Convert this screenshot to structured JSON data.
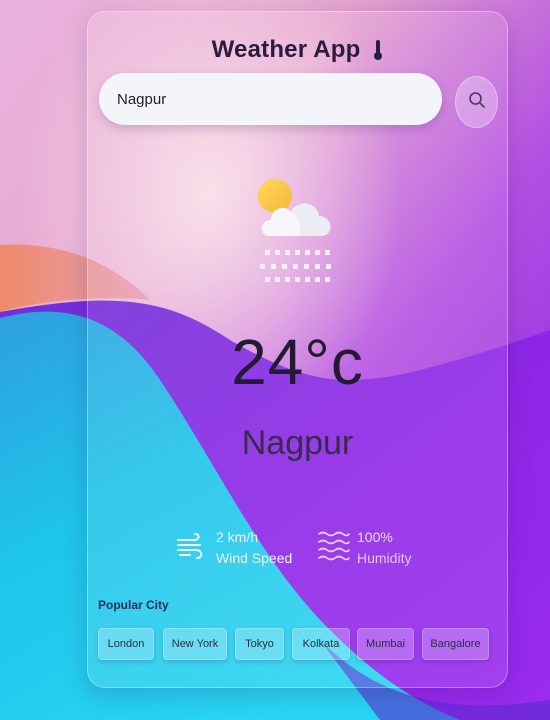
{
  "app": {
    "title": "Weather App",
    "title_icon": "thermometer-icon"
  },
  "search": {
    "value": "Nagpur",
    "button_icon": "search-icon"
  },
  "current": {
    "condition_icon": "partly-cloudy-snow-icon",
    "temperature": "24°c",
    "city": "Nagpur"
  },
  "stats": {
    "wind": {
      "value": "2 km/h",
      "label": "Wind Speed",
      "icon": "wind-icon"
    },
    "humidity": {
      "value": "100%",
      "label": "Humidity",
      "icon": "waves-icon"
    }
  },
  "popular": {
    "title": "Popular City",
    "cities": [
      "London",
      "New York",
      "Tokyo",
      "Kolkata",
      "Mumbai",
      "Bangalore"
    ]
  },
  "colors": {
    "accent_purple": "#8a1fe0",
    "cyan": "#20c6ea",
    "text_dark": "#241a33"
  }
}
